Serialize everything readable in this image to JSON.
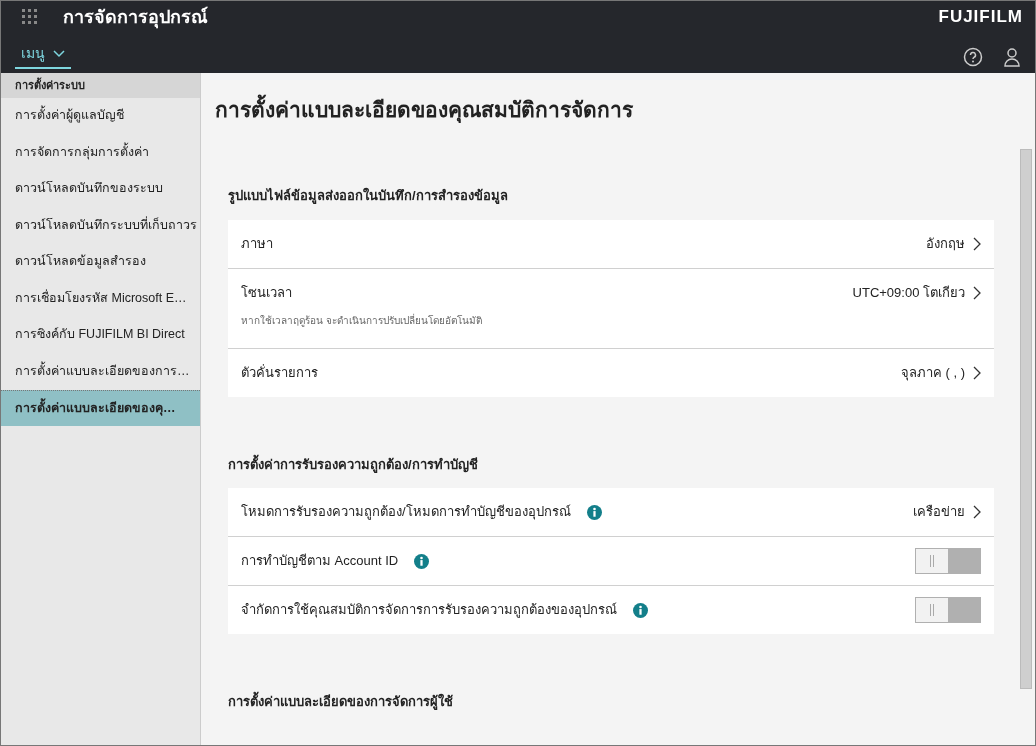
{
  "header": {
    "title": "การจัดการอุปกรณ์",
    "brand": "FUJIFILM",
    "menu_label": "เมนู"
  },
  "sidebar": {
    "group_label": "การตั้งค่าระบบ",
    "items": [
      {
        "label": "การตั้งค่าผู้ดูแลบัญชี",
        "selected": false
      },
      {
        "label": "การจัดการกลุ่มการตั้งค่า",
        "selected": false
      },
      {
        "label": "ดาวน์โหลดบันทึกของระบบ",
        "selected": false
      },
      {
        "label": "ดาวน์โหลดบันทึกระบบที่เก็บถาวร",
        "selected": false
      },
      {
        "label": "ดาวน์โหลดข้อมูลสำรอง",
        "selected": false
      },
      {
        "label": "การเชื่อมโยงรหัส Microsoft E…",
        "selected": false
      },
      {
        "label": "การซิงค์กับ FUJIFILM BI Direct",
        "selected": false
      },
      {
        "label": "การตั้งค่าแบบละเอียดของการ…",
        "selected": false
      },
      {
        "label": "การตั้งค่าแบบละเอียดของคุ…",
        "selected": true
      }
    ]
  },
  "page_title": "การตั้งค่าแบบละเอียดของคุณสมบัติการจัดการ",
  "sections": [
    {
      "heading": "รูปแบบไฟล์ข้อมูลส่งออกในบันทึก/การสำรองข้อมูล",
      "rows": [
        {
          "kind": "link",
          "label": "ภาษา",
          "value": "อังกฤษ"
        },
        {
          "kind": "link",
          "label": "โซนเวลา",
          "value": "UTC+09:00 โตเกียว",
          "note": "หากใช้เวลาฤดูร้อน จะดำเนินการปรับเปลี่ยนโดยอัตโนมัติ"
        },
        {
          "kind": "link",
          "label": "ตัวคั่นรายการ",
          "value": "จุลภาค ( , )"
        }
      ]
    },
    {
      "heading": "การตั้งค่าการรับรองความถูกต้อง/การทำบัญชี",
      "rows": [
        {
          "kind": "link",
          "label": "โหมดการรับรองความถูกต้อง/โหมดการทำบัญชีของอุปกรณ์",
          "value": "เครือข่าย",
          "info": true
        },
        {
          "kind": "toggle",
          "label": "การทำบัญชีตาม Account ID",
          "on": false,
          "info": true
        },
        {
          "kind": "toggle",
          "label": "จำกัดการใช้คุณสมบัติการจัดการการรับรองความถูกต้องของอุปกรณ์",
          "on": false,
          "info": true
        }
      ]
    },
    {
      "heading": "การตั้งค่าแบบละเอียดของการจัดการผู้ใช้"
    }
  ]
}
